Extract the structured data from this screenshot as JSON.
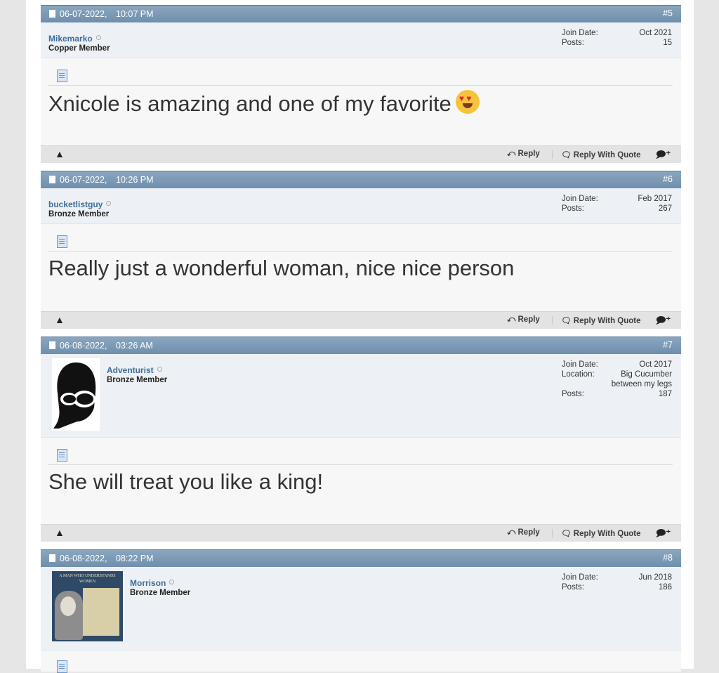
{
  "posts": [
    {
      "date": "06-07-2022,",
      "time": "10:07 PM",
      "num": "#5",
      "user": "Mikemarko",
      "title": "Copper Member",
      "stats": [
        {
          "k": "Join Date:",
          "v": "Oct 2021"
        },
        {
          "k": "Posts:",
          "v": "15"
        }
      ],
      "message": "Xnicole is amazing and one of my favorite"
    },
    {
      "date": "06-07-2022,",
      "time": "10:26 PM",
      "num": "#6",
      "user": "bucketlistguy",
      "title": "Bronze Member",
      "stats": [
        {
          "k": "Join Date:",
          "v": "Feb 2017"
        },
        {
          "k": "Posts:",
          "v": "267"
        }
      ],
      "message": "Really just a wonderful woman, nice nice person"
    },
    {
      "date": "06-08-2022,",
      "time": "03:26 AM",
      "num": "#7",
      "user": "Adventurist",
      "title": "Bronze Member",
      "stats": [
        {
          "k": "Join Date:",
          "v": "Oct 2017"
        },
        {
          "k": "Location:",
          "v": "Big Cucumber between my legs"
        },
        {
          "k": "Posts:",
          "v": "187"
        }
      ],
      "message": "She will treat you like a king!"
    },
    {
      "date": "06-08-2022,",
      "time": "08:22 PM",
      "num": "#8",
      "user": "Morrison",
      "title": "Bronze Member",
      "stats": [
        {
          "k": "Join Date:",
          "v": "Jun 2018"
        },
        {
          "k": "Posts:",
          "v": "186"
        }
      ],
      "avatar_text": "A MAN WHO UNDERSTANDS WOMEN"
    }
  ],
  "actions": {
    "reply": "Reply",
    "quote": "Reply With Quote"
  },
  "icons": {
    "warn": "report-icon",
    "multi": "multiquote-icon",
    "reply": "reply-arrow-icon",
    "quote": "quote-bubble-icon"
  }
}
